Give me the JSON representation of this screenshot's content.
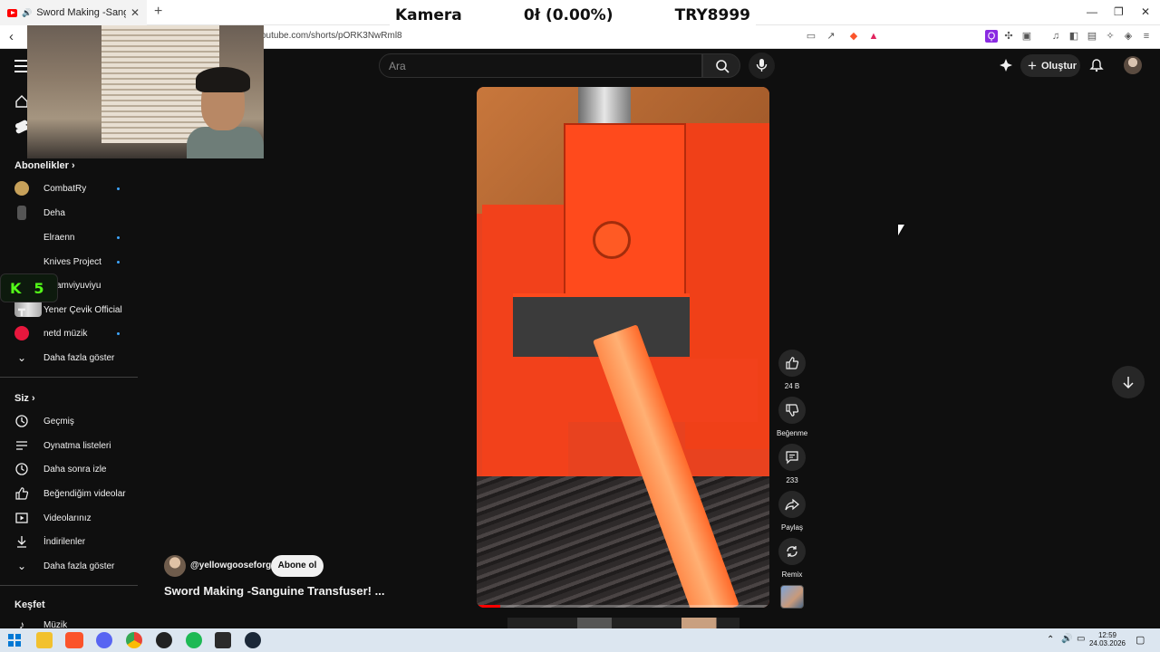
{
  "browser": {
    "tab_title": "Sword Making -Sanguine Tra",
    "url": "outube.com/shorts/pORK3NwRml8"
  },
  "ticker": {
    "label": "Kamera",
    "value": "0ł (0.00%)",
    "goal": "TRY8999"
  },
  "youtube": {
    "search_placeholder": "Ara",
    "create_label": "Oluştur"
  },
  "sidebar": {
    "subscriptions_heading": "Abonelikler",
    "subscriptions": [
      {
        "label": "CombatRy",
        "new": true
      },
      {
        "label": "Deha",
        "new": false
      },
      {
        "label": "Elraenn",
        "new": true
      },
      {
        "label": "Knives Project",
        "new": true
      },
      {
        "label": "amviyuviyu",
        "new": false
      },
      {
        "label": "Yener Çevik Official",
        "new": false
      },
      {
        "label": "netd müzik",
        "new": true
      }
    ],
    "show_more_subs": "Daha fazla göster",
    "you_heading": "Siz",
    "you_items": [
      {
        "label": "Geçmiş",
        "icon": "history-icon"
      },
      {
        "label": "Oynatma listeleri",
        "icon": "playlist-icon"
      },
      {
        "label": "Daha sonra izle",
        "icon": "clock-icon"
      },
      {
        "label": "Beğendiğim videolar",
        "icon": "like-icon"
      },
      {
        "label": "Videolarınız",
        "icon": "video-icon"
      },
      {
        "label": "İndirilenler",
        "icon": "download-icon"
      }
    ],
    "show_more_you": "Daha fazla göster",
    "explore_heading": "Keşfet",
    "explore_items": [
      {
        "label": "Müzik",
        "icon": "music-icon"
      }
    ]
  },
  "kick_badge": {
    "logo": "K",
    "count": "5"
  },
  "short": {
    "channel": "@yellowgooseforge",
    "subscribe_label": "Abone ol",
    "title": "Sword Making -Sanguine Transfuser! ...",
    "likes": "24 B",
    "dislike_label": "Beğenme",
    "comments": "233",
    "share_label": "Paylaş",
    "remix_label": "Remix",
    "progress": 0.08
  },
  "taskbar": {
    "time": "12:59",
    "date": "24.03.2026"
  },
  "colors": {
    "accent": "#ff0000",
    "new_dot": "#3ea6ff",
    "kick": "#53fc18"
  }
}
